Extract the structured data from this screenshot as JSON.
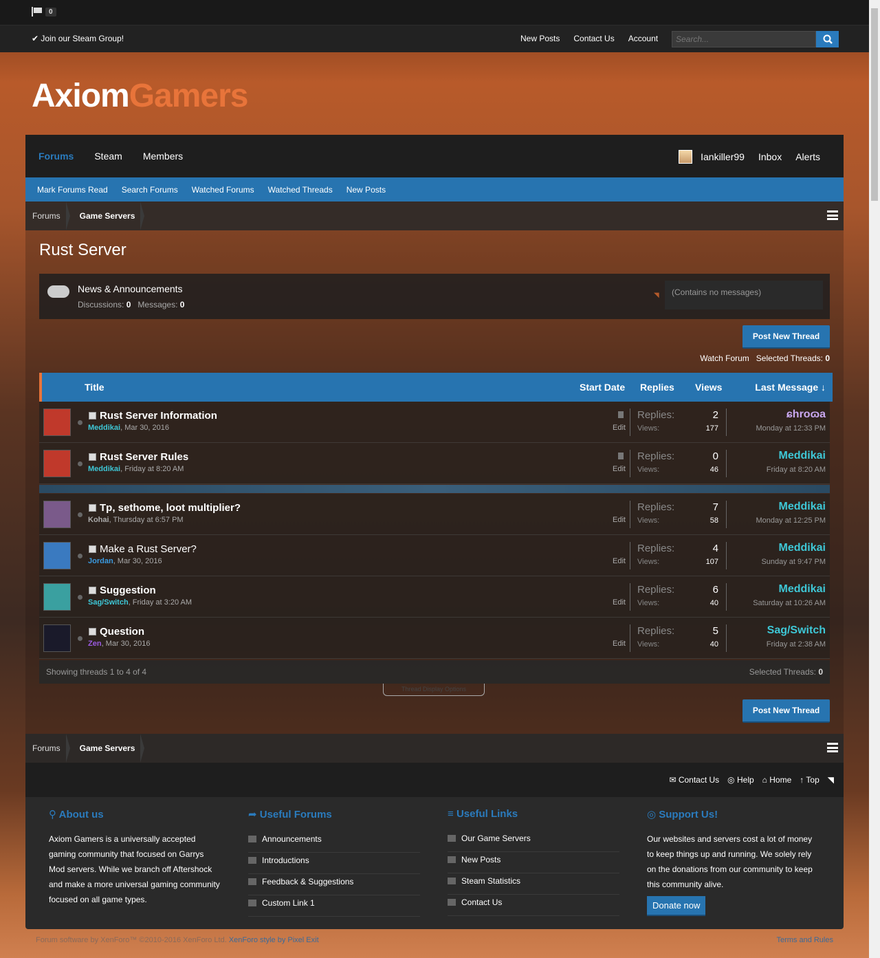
{
  "topbar": {
    "flag_count": "0"
  },
  "subbar": {
    "steam_link": "Join our Steam Group!",
    "nav": [
      "New Posts",
      "Contact Us",
      "Account"
    ],
    "search_placeholder": "Search..."
  },
  "logo": {
    "part1": "Axiom",
    "part2": "Gamers"
  },
  "nav1": {
    "tabs": [
      "Forums",
      "Steam",
      "Members"
    ],
    "username": "Iankiller99",
    "inbox": "Inbox",
    "alerts": "Alerts"
  },
  "nav2": [
    "Mark Forums Read",
    "Search Forums",
    "Watched Forums",
    "Watched Threads",
    "New Posts"
  ],
  "breadcrumb": [
    "Forums",
    "Game Servers"
  ],
  "page_title": "Rust Server",
  "subforum": {
    "title": "News & Announcements",
    "discussions_label": "Discussions:",
    "discussions": "0",
    "messages_label": "Messages:",
    "messages": "0",
    "last": "(Contains no messages)"
  },
  "post_new_thread": "Post New Thread",
  "watch_forum": "Watch Forum",
  "selected_threads_label": "Selected Threads:",
  "selected_threads": "0",
  "table_head": {
    "title": "Title",
    "start_date": "Start Date",
    "replies": "Replies",
    "views": "Views",
    "last_message": "Last Message ↓"
  },
  "threads": [
    {
      "title": "Rust Server Information",
      "bold": true,
      "author": "Meddikai",
      "author_color": "#3ec7d6",
      "date": ", Mar 30, 2016",
      "replies": "2",
      "views": "177",
      "last_user": "ɕhroɷa",
      "last_color": "#c9a8f0",
      "last_date": "Monday at 12:33 PM",
      "sticky": true
    },
    {
      "title": "Rust Server Rules",
      "bold": true,
      "author": "Meddikai",
      "author_color": "#3ec7d6",
      "date": ", Friday at 8:20 AM",
      "replies": "0",
      "views": "46",
      "last_user": "Meddikai",
      "last_color": "#3ec7d6",
      "last_date": "Friday at 8:20 AM",
      "sticky": true
    },
    {
      "title": "Tp, sethome, loot multiplier?",
      "bold": true,
      "author": "Kohai",
      "author_color": "#aaa",
      "date": ", Thursday at 6:57 PM",
      "replies": "7",
      "views": "58",
      "last_user": "Meddikai",
      "last_color": "#3ec7d6",
      "last_date": "Monday at 12:25 PM",
      "sticky": false
    },
    {
      "title": "Make a Rust Server?",
      "bold": false,
      "author": "Jordan",
      "author_color": "#3a9ae0",
      "date": ", Mar 30, 2016",
      "replies": "4",
      "views": "107",
      "last_user": "Meddikai",
      "last_color": "#3ec7d6",
      "last_date": "Sunday at 9:47 PM",
      "sticky": false
    },
    {
      "title": "Suggestion",
      "bold": true,
      "author": "Sag/Switch",
      "author_color": "#3ec7d6",
      "date": ", Friday at 3:20 AM",
      "replies": "6",
      "views": "40",
      "last_user": "Meddikai",
      "last_color": "#3ec7d6",
      "last_date": "Saturday at 10:26 AM",
      "sticky": false
    },
    {
      "title": "Question",
      "bold": true,
      "author": "Zen",
      "author_color": "#9a5ae0",
      "date": ", Mar 30, 2016",
      "replies": "5",
      "views": "40",
      "last_user": "Sag/Switch",
      "last_color": "#3ec7d6",
      "last_date": "Friday at 2:38 AM",
      "sticky": false
    }
  ],
  "row_labels": {
    "replies": "Replies:",
    "views": "Views:",
    "edit": "Edit"
  },
  "showing": "Showing threads 1 to 4 of 4",
  "thread_display_options": "Thread Display Options",
  "footer_links": [
    "Contact Us",
    "Help",
    "Home",
    "Top"
  ],
  "about": {
    "title": "About us",
    "text": "Axiom Gamers is a universally accepted gaming community that focused on Garrys Mod servers. While we branch off Aftershock and make a more universal gaming community focused on all game types."
  },
  "useful_forums": {
    "title": "Useful Forums",
    "items": [
      "Announcements",
      "Introductions",
      "Feedback & Suggestions",
      "Custom Link 1"
    ]
  },
  "useful_links": {
    "title": "Useful Links",
    "items": [
      "Our Game Servers",
      "New Posts",
      "Steam Statistics",
      "Contact Us"
    ]
  },
  "support": {
    "title": "Support Us!",
    "text": "Our websites and servers cost a lot of money to keep things up and running. We solely rely on the donations from our community to keep this community alive.",
    "button": "Donate now"
  },
  "copyright": {
    "text": "Forum software by XenForo™ ©2010-2016 XenForo Ltd.",
    "style": "XenForo style by Pixel Exit"
  },
  "terms": "Terms and Rules"
}
